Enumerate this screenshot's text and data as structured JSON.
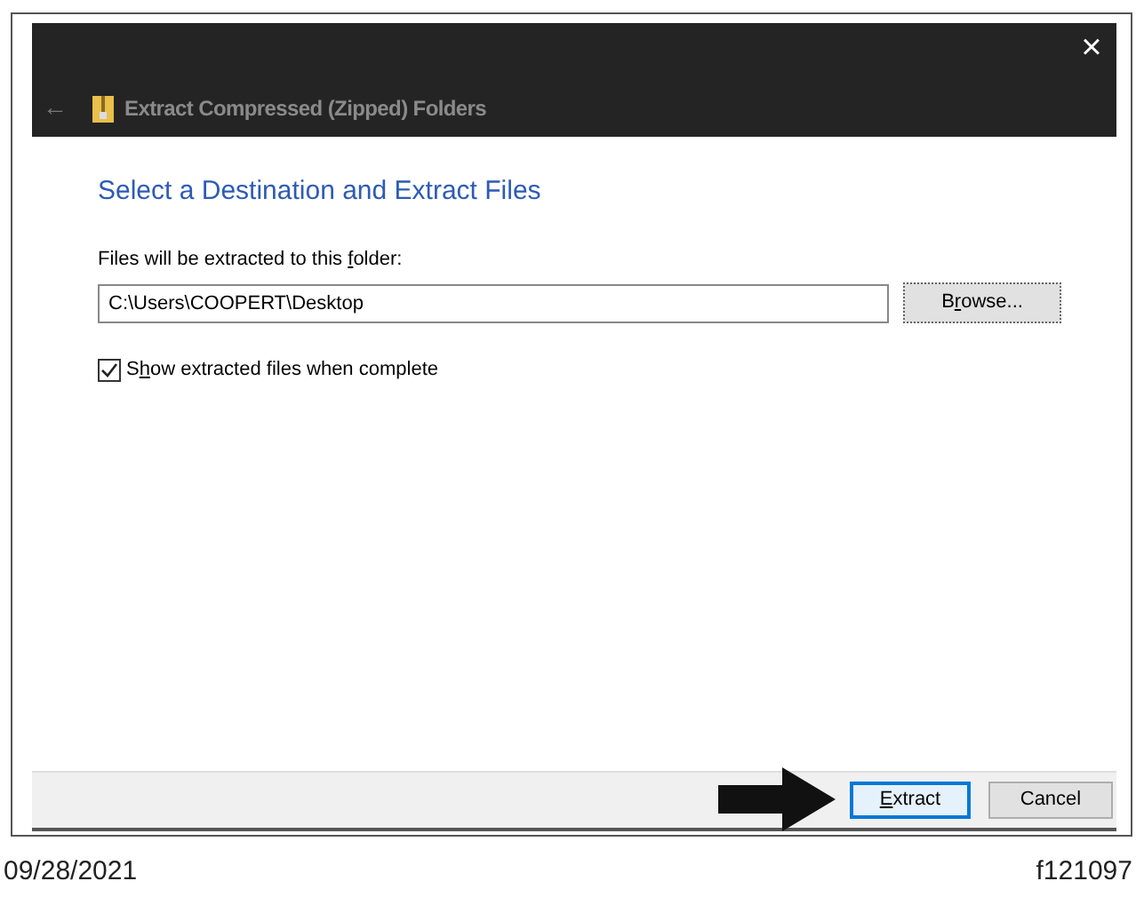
{
  "window": {
    "title": "Extract Compressed (Zipped) Folders",
    "close_glyph": "×",
    "back_glyph": "←"
  },
  "heading": "Select a Destination and Extract Files",
  "folder_label": [
    "Files will be extracted to this ",
    "f",
    "older:"
  ],
  "folder_field": {
    "value": "C:\\Users\\COOPERT\\Desktop"
  },
  "browse_button": [
    "B",
    "r",
    "owse..."
  ],
  "show_files": {
    "label": [
      "S",
      "h",
      "ow extracted files when complete"
    ],
    "checked": true
  },
  "buttons": [
    {
      "key": "E",
      "rest": "xtract",
      "default": true
    },
    {
      "rest": "Cancel",
      "default": false
    }
  ],
  "caption": {
    "date": "09/28/2021",
    "figure_id": "f121097"
  }
}
